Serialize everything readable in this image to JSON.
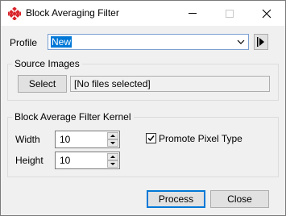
{
  "window": {
    "title": "Block Averaging Filter"
  },
  "profile": {
    "label": "Profile",
    "value": "New"
  },
  "source_images": {
    "group_title": "Source Images",
    "select_button": "Select",
    "files_text": "[No files selected]"
  },
  "kernel": {
    "group_title": "Block Average Filter Kernel",
    "width_label": "Width",
    "width_value": "10",
    "height_label": "Height",
    "height_value": "10",
    "promote_label": "Promote Pixel Type",
    "promote_checked": true
  },
  "actions": {
    "process": "Process",
    "close": "Close"
  },
  "icons": {
    "app": "block-filter-icon",
    "minimize": "minimize-icon",
    "maximize": "maximize-icon",
    "close": "close-icon",
    "dropdown": "chevron-down-icon",
    "play": "play-icon",
    "spin_up": "spin-up-icon",
    "spin_down": "spin-down-icon",
    "check": "checkmark-icon"
  },
  "colors": {
    "accent": "#0078d7",
    "app_icon": "#d9252b"
  }
}
